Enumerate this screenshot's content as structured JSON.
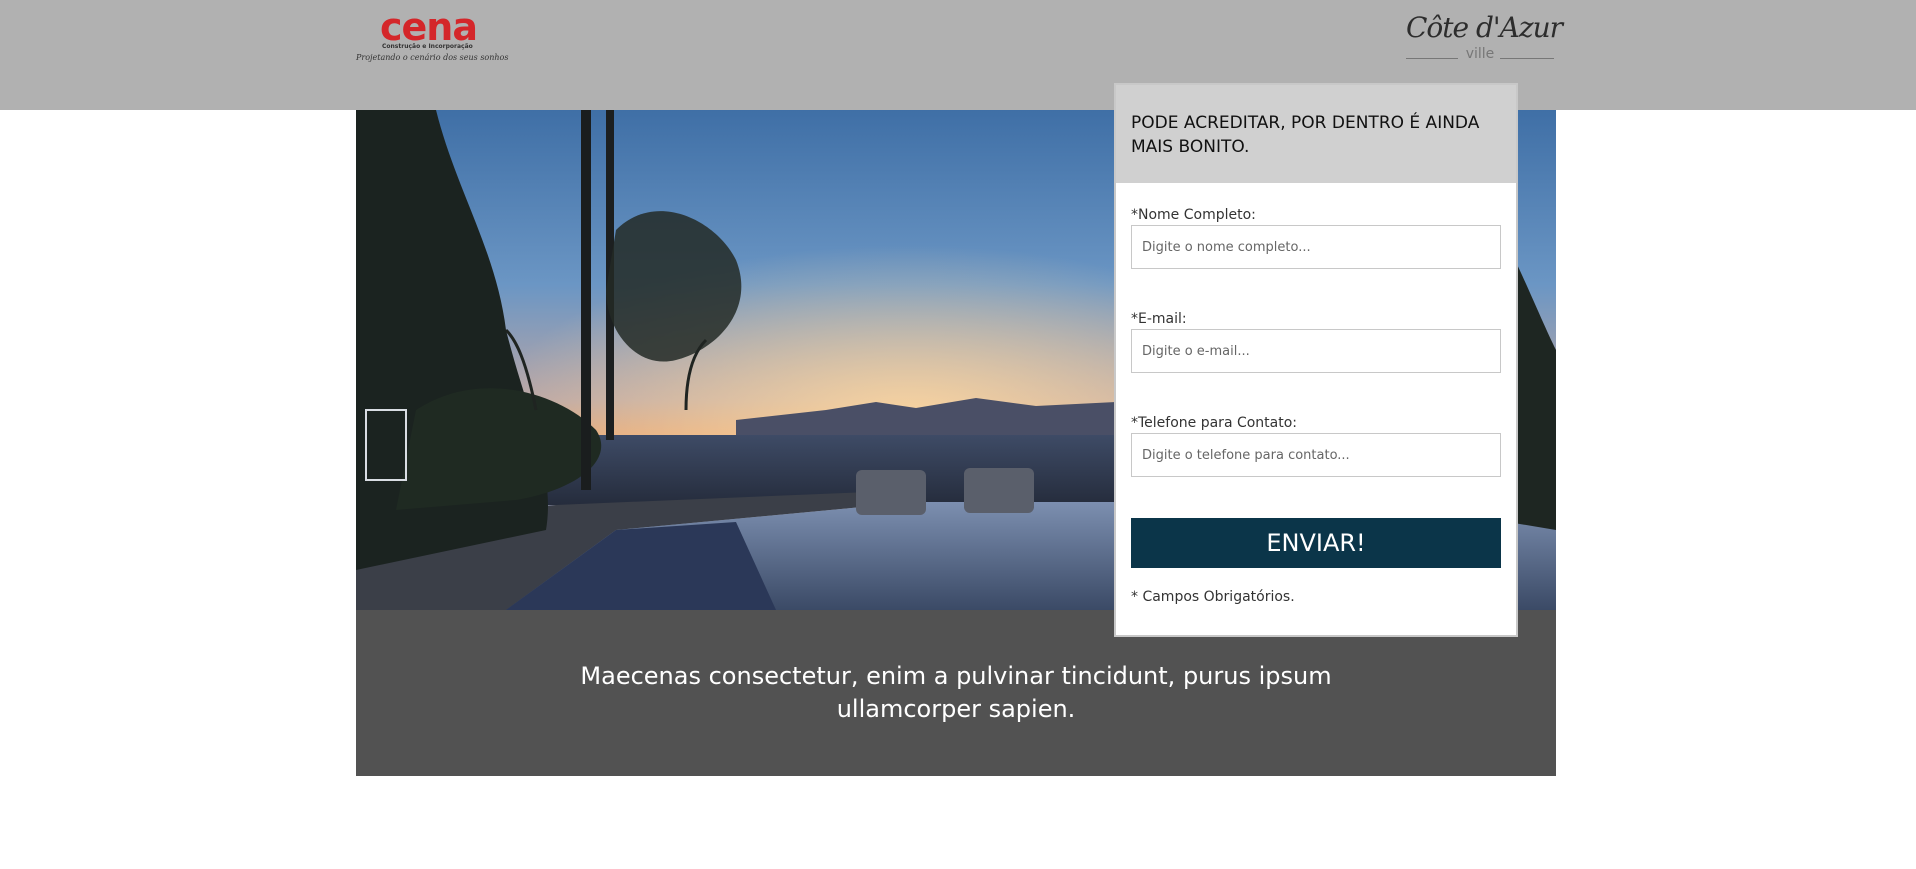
{
  "header": {
    "brand_left": {
      "name": "cena",
      "subtitle": "Construção e Incorporação",
      "tagline": "Projetando o cenário dos seus sonhos",
      "color": "#d4262a"
    },
    "brand_right": {
      "name": "Côte d'Azur",
      "suffix": "ville"
    }
  },
  "form": {
    "title_line1": "PODE ACREDITAR, POR DENTRO É AINDA",
    "title_line2": "MAIS BONITO.",
    "fields": [
      {
        "label": "*Nome Completo:",
        "placeholder": "Digite o nome completo...",
        "value": ""
      },
      {
        "label": "*E-mail:",
        "placeholder": "Digite o e-mail...",
        "value": ""
      },
      {
        "label": "*Telefone para Contato:",
        "placeholder": "Digite o telefone para contato...",
        "value": ""
      }
    ],
    "submit_label": "ENVIAR!",
    "submit_color": "#0b3549",
    "required_note": "* Campos Obrigatórios."
  },
  "band": {
    "line1": "Maecenas consectetur, enim a pulvinar tincidunt, purus ipsum",
    "line2": "ullamcorper sapien."
  }
}
